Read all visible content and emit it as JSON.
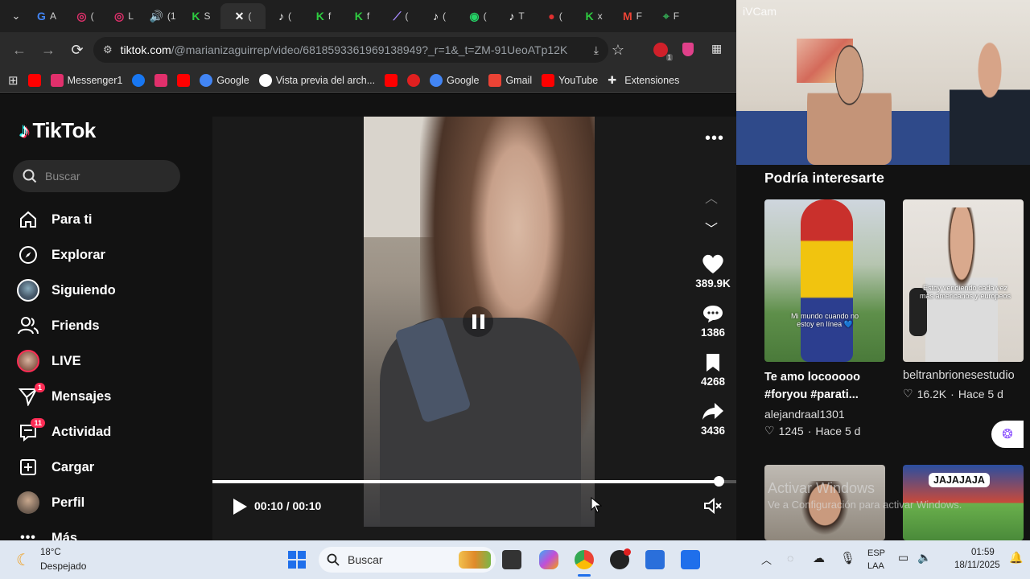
{
  "browser": {
    "tabs": [
      {
        "label": "A",
        "color": "#4285f4",
        "glyph": "G"
      },
      {
        "label": "(",
        "color": "#e1306c",
        "glyph": "◎"
      },
      {
        "label": "L",
        "color": "#e1306c",
        "glyph": "◎"
      },
      {
        "label": "(1",
        "color": "#cccccc",
        "glyph": "🔊"
      },
      {
        "label": "S",
        "color": "#2ecc40",
        "glyph": "K"
      },
      {
        "label": "(",
        "color": "#ffffff",
        "glyph": "✕"
      },
      {
        "label": "(",
        "color": "#ffffff",
        "glyph": "♪"
      },
      {
        "label": "f",
        "color": "#2ecc40",
        "glyph": "K"
      },
      {
        "label": "f",
        "color": "#2ecc40",
        "glyph": "K"
      },
      {
        "label": "(",
        "color": "#a98bff",
        "glyph": "⟋"
      },
      {
        "label": "(",
        "color": "#ffffff",
        "glyph": "♪"
      },
      {
        "label": "(",
        "color": "#25d366",
        "glyph": "◉"
      },
      {
        "label": "T",
        "color": "#ffffff",
        "glyph": "♪"
      },
      {
        "label": "(",
        "color": "#e03030",
        "glyph": "●"
      },
      {
        "label": "x",
        "color": "#2ecc40",
        "glyph": "K"
      },
      {
        "label": "F",
        "color": "#ea4335",
        "glyph": "M"
      },
      {
        "label": "F",
        "color": "#34a853",
        "glyph": "⌖"
      }
    ],
    "url_host": "tiktok.com",
    "url_rest": "/@marianizaguirrep/video/6818593361969138949?_r=1&_t=ZM-91UeoATp12K",
    "extension_badge": "1",
    "bookmarks": [
      {
        "label": "",
        "icon": "youtube-icon",
        "color": "#ff0000"
      },
      {
        "label": "Messenger1",
        "icon": "instagram-icon",
        "color": "#e1306c"
      },
      {
        "label": "",
        "icon": "facebook-icon",
        "color": "#1877f2"
      },
      {
        "label": "",
        "icon": "instagram-icon",
        "color": "#e1306c"
      },
      {
        "label": "",
        "icon": "youtube-icon",
        "color": "#ff0000"
      },
      {
        "label": "Google",
        "icon": "google-icon",
        "color": "#4285f4"
      },
      {
        "label": "Vista previa del arch...",
        "icon": "globe-icon",
        "color": "#ffffff"
      },
      {
        "label": "",
        "icon": "youtube-icon",
        "color": "#ff0000"
      },
      {
        "label": "",
        "icon": "red-app-icon",
        "color": "#e02020"
      },
      {
        "label": "Google",
        "icon": "google-icon",
        "color": "#4285f4"
      },
      {
        "label": "Gmail",
        "icon": "gmail-icon",
        "color": "#ea4335"
      },
      {
        "label": "YouTube",
        "icon": "youtube-icon",
        "color": "#ff0000"
      },
      {
        "label": "Extensiones",
        "icon": "puzzle-icon",
        "color": "#e6e6e6"
      }
    ]
  },
  "tiktok": {
    "logo": "TikTok",
    "search_placeholder": "Buscar",
    "nav": [
      {
        "label": "Para ti",
        "icon": "home-icon",
        "badge": ""
      },
      {
        "label": "Explorar",
        "icon": "compass-icon",
        "badge": ""
      },
      {
        "label": "Siguiendo",
        "icon": "avatar-icon",
        "badge": ""
      },
      {
        "label": "Friends",
        "icon": "friends-icon",
        "badge": ""
      },
      {
        "label": "LIVE",
        "icon": "live-avatar-icon",
        "badge": ""
      },
      {
        "label": "Mensajes",
        "icon": "send-icon",
        "badge": "1"
      },
      {
        "label": "Actividad",
        "icon": "inbox-icon",
        "badge": "11"
      },
      {
        "label": "Cargar",
        "icon": "plus-square-icon",
        "badge": ""
      },
      {
        "label": "Perfil",
        "icon": "profile-avatar-icon",
        "badge": ""
      },
      {
        "label": "Más",
        "icon": "more-icon",
        "badge": ""
      }
    ],
    "video": {
      "likes": "389.9K",
      "comments": "1386",
      "saves": "4268",
      "shares": "3436",
      "time": "00:10 / 00:10",
      "progress": 0.95
    }
  },
  "camera_overlay": {
    "label": "iVCam"
  },
  "suggestions": {
    "title": "Podría interesarte",
    "items": [
      {
        "caption": "Mi mundo cuando no estoy en línea 💙",
        "title_line1": "Te amo locooooo",
        "title_line2": "#foryou #parati...",
        "author": "alejandraal1301",
        "likes": "1245",
        "age": "Hace 5 d"
      },
      {
        "caption": "Estoy vendiendo cada vez más americanos y europeos",
        "title_line1": "",
        "title_line2": "",
        "author": "beltranbrionesestudio",
        "likes": "16.2K",
        "age": "Hace 5 d"
      },
      {
        "caption": "",
        "title_line1": "",
        "title_line2": "",
        "author": "",
        "likes": "",
        "age": ""
      },
      {
        "caption": "JAJAJAJA",
        "title_line1": "",
        "title_line2": "",
        "author": "",
        "likes": "",
        "age": ""
      }
    ],
    "watermark_line1": "Activar Windows",
    "watermark_line2": "Ve a Configuración para activar Windows."
  },
  "taskbar": {
    "weather_temp": "18°C",
    "weather_desc": "Despejado",
    "search_placeholder": "Buscar",
    "lang_line1": "ESP",
    "lang_line2": "LAA",
    "time": "01:59",
    "date": "18/11/2025"
  }
}
